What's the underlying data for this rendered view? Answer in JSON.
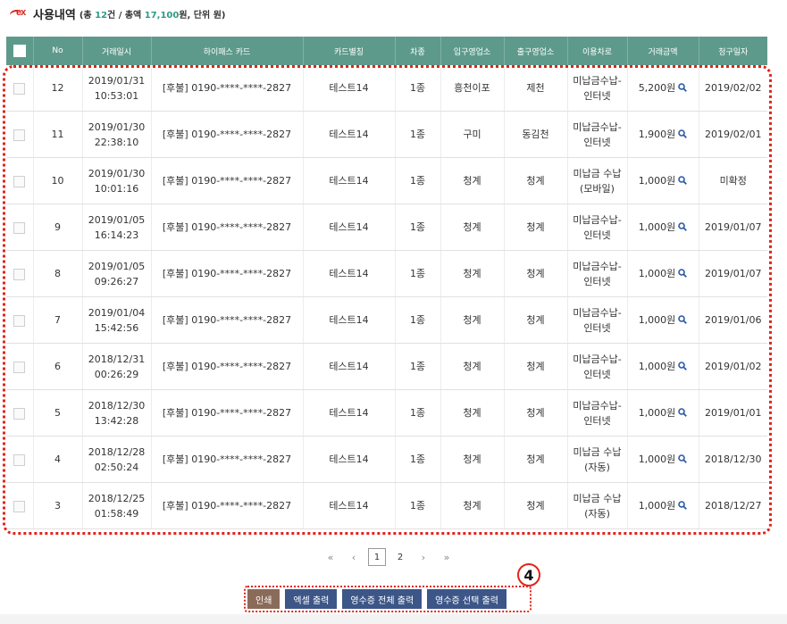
{
  "header": {
    "logo_text": "ex",
    "title": "사용내역",
    "summary_pre": "(총 ",
    "summary_count": "12",
    "summary_mid": "건 / 총액 ",
    "summary_total": "17,100",
    "summary_post": "원, 단위 원)"
  },
  "columns": [
    "No",
    "거래일시",
    "하이패스 카드",
    "카드별칭",
    "차종",
    "입구영업소",
    "출구영업소",
    "이용차로",
    "거래금액",
    "청구일자"
  ],
  "rows": [
    {
      "no": "12",
      "date": "2019/01/31",
      "time": "10:53:01",
      "card": "[후불] 0190-****-****-2827",
      "alias": "테스트14",
      "type": "1종",
      "entry": "흥천이포",
      "exit": "제천",
      "lane1": "미납금수납-",
      "lane2": "인터넷",
      "amount": "5,200원",
      "billing": "2019/02/02"
    },
    {
      "no": "11",
      "date": "2019/01/30",
      "time": "22:38:10",
      "card": "[후불] 0190-****-****-2827",
      "alias": "테스트14",
      "type": "1종",
      "entry": "구미",
      "exit": "동김천",
      "lane1": "미납금수납-",
      "lane2": "인터넷",
      "amount": "1,900원",
      "billing": "2019/02/01"
    },
    {
      "no": "10",
      "date": "2019/01/30",
      "time": "10:01:16",
      "card": "[후불] 0190-****-****-2827",
      "alias": "테스트14",
      "type": "1종",
      "entry": "청계",
      "exit": "청계",
      "lane1": "미납금 수납",
      "lane2": "(모바일)",
      "amount": "1,000원",
      "billing": "미확정"
    },
    {
      "no": "9",
      "date": "2019/01/05",
      "time": "16:14:23",
      "card": "[후불] 0190-****-****-2827",
      "alias": "테스트14",
      "type": "1종",
      "entry": "청계",
      "exit": "청계",
      "lane1": "미납금수납-",
      "lane2": "인터넷",
      "amount": "1,000원",
      "billing": "2019/01/07"
    },
    {
      "no": "8",
      "date": "2019/01/05",
      "time": "09:26:27",
      "card": "[후불] 0190-****-****-2827",
      "alias": "테스트14",
      "type": "1종",
      "entry": "청계",
      "exit": "청계",
      "lane1": "미납금수납-",
      "lane2": "인터넷",
      "amount": "1,000원",
      "billing": "2019/01/07"
    },
    {
      "no": "7",
      "date": "2019/01/04",
      "time": "15:42:56",
      "card": "[후불] 0190-****-****-2827",
      "alias": "테스트14",
      "type": "1종",
      "entry": "청계",
      "exit": "청계",
      "lane1": "미납금수납-",
      "lane2": "인터넷",
      "amount": "1,000원",
      "billing": "2019/01/06"
    },
    {
      "no": "6",
      "date": "2018/12/31",
      "time": "00:26:29",
      "card": "[후불] 0190-****-****-2827",
      "alias": "테스트14",
      "type": "1종",
      "entry": "청계",
      "exit": "청계",
      "lane1": "미납금수납-",
      "lane2": "인터넷",
      "amount": "1,000원",
      "billing": "2019/01/02"
    },
    {
      "no": "5",
      "date": "2018/12/30",
      "time": "13:42:28",
      "card": "[후불] 0190-****-****-2827",
      "alias": "테스트14",
      "type": "1종",
      "entry": "청계",
      "exit": "청계",
      "lane1": "미납금수납-",
      "lane2": "인터넷",
      "amount": "1,000원",
      "billing": "2019/01/01"
    },
    {
      "no": "4",
      "date": "2018/12/28",
      "time": "02:50:24",
      "card": "[후불] 0190-****-****-2827",
      "alias": "테스트14",
      "type": "1종",
      "entry": "청계",
      "exit": "청계",
      "lane1": "미납금 수납",
      "lane2": "(자동)",
      "amount": "1,000원",
      "billing": "2018/12/30"
    },
    {
      "no": "3",
      "date": "2018/12/25",
      "time": "01:58:49",
      "card": "[후불] 0190-****-****-2827",
      "alias": "테스트14",
      "type": "1종",
      "entry": "청계",
      "exit": "청계",
      "lane1": "미납금 수납",
      "lane2": "(자동)",
      "amount": "1,000원",
      "billing": "2018/12/27"
    }
  ],
  "pagination": {
    "first": "«",
    "prev": "‹",
    "pages": [
      "1",
      "2"
    ],
    "current": "1",
    "next": "›",
    "last": "»"
  },
  "buttons": {
    "print": "인쇄",
    "excel": "엑셀 출력",
    "receipt_all": "영수증 전체 출력",
    "receipt_selected": "영수증 선택 출력"
  },
  "annotation": {
    "number": "4"
  },
  "colors": {
    "header_bg": "#5e9a8b",
    "accent": "#2e9a87",
    "highlight": "#e2231a",
    "print_button": "#8a6b5a",
    "action_button": "#3d5688"
  },
  "icons": {
    "row_search": "magnifier-icon",
    "logo": "ex-logo"
  }
}
